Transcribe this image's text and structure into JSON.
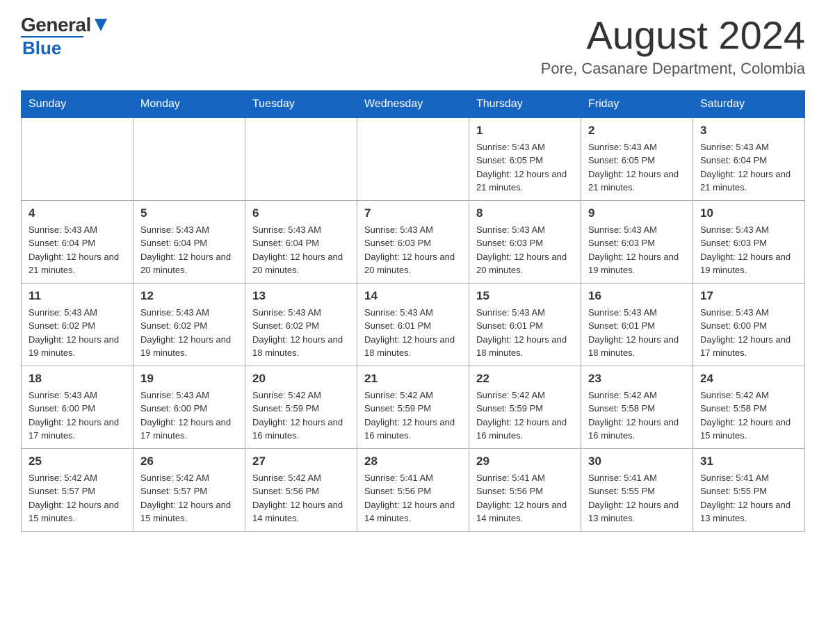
{
  "header": {
    "logo_general": "General",
    "logo_blue": "Blue",
    "month_title": "August 2024",
    "location": "Pore, Casanare Department, Colombia"
  },
  "days_of_week": [
    "Sunday",
    "Monday",
    "Tuesday",
    "Wednesday",
    "Thursday",
    "Friday",
    "Saturday"
  ],
  "weeks": [
    [
      {
        "day": "",
        "sunrise": "",
        "sunset": "",
        "daylight": ""
      },
      {
        "day": "",
        "sunrise": "",
        "sunset": "",
        "daylight": ""
      },
      {
        "day": "",
        "sunrise": "",
        "sunset": "",
        "daylight": ""
      },
      {
        "day": "",
        "sunrise": "",
        "sunset": "",
        "daylight": ""
      },
      {
        "day": "1",
        "sunrise": "Sunrise: 5:43 AM",
        "sunset": "Sunset: 6:05 PM",
        "daylight": "Daylight: 12 hours and 21 minutes."
      },
      {
        "day": "2",
        "sunrise": "Sunrise: 5:43 AM",
        "sunset": "Sunset: 6:05 PM",
        "daylight": "Daylight: 12 hours and 21 minutes."
      },
      {
        "day": "3",
        "sunrise": "Sunrise: 5:43 AM",
        "sunset": "Sunset: 6:04 PM",
        "daylight": "Daylight: 12 hours and 21 minutes."
      }
    ],
    [
      {
        "day": "4",
        "sunrise": "Sunrise: 5:43 AM",
        "sunset": "Sunset: 6:04 PM",
        "daylight": "Daylight: 12 hours and 21 minutes."
      },
      {
        "day": "5",
        "sunrise": "Sunrise: 5:43 AM",
        "sunset": "Sunset: 6:04 PM",
        "daylight": "Daylight: 12 hours and 20 minutes."
      },
      {
        "day": "6",
        "sunrise": "Sunrise: 5:43 AM",
        "sunset": "Sunset: 6:04 PM",
        "daylight": "Daylight: 12 hours and 20 minutes."
      },
      {
        "day": "7",
        "sunrise": "Sunrise: 5:43 AM",
        "sunset": "Sunset: 6:03 PM",
        "daylight": "Daylight: 12 hours and 20 minutes."
      },
      {
        "day": "8",
        "sunrise": "Sunrise: 5:43 AM",
        "sunset": "Sunset: 6:03 PM",
        "daylight": "Daylight: 12 hours and 20 minutes."
      },
      {
        "day": "9",
        "sunrise": "Sunrise: 5:43 AM",
        "sunset": "Sunset: 6:03 PM",
        "daylight": "Daylight: 12 hours and 19 minutes."
      },
      {
        "day": "10",
        "sunrise": "Sunrise: 5:43 AM",
        "sunset": "Sunset: 6:03 PM",
        "daylight": "Daylight: 12 hours and 19 minutes."
      }
    ],
    [
      {
        "day": "11",
        "sunrise": "Sunrise: 5:43 AM",
        "sunset": "Sunset: 6:02 PM",
        "daylight": "Daylight: 12 hours and 19 minutes."
      },
      {
        "day": "12",
        "sunrise": "Sunrise: 5:43 AM",
        "sunset": "Sunset: 6:02 PM",
        "daylight": "Daylight: 12 hours and 19 minutes."
      },
      {
        "day": "13",
        "sunrise": "Sunrise: 5:43 AM",
        "sunset": "Sunset: 6:02 PM",
        "daylight": "Daylight: 12 hours and 18 minutes."
      },
      {
        "day": "14",
        "sunrise": "Sunrise: 5:43 AM",
        "sunset": "Sunset: 6:01 PM",
        "daylight": "Daylight: 12 hours and 18 minutes."
      },
      {
        "day": "15",
        "sunrise": "Sunrise: 5:43 AM",
        "sunset": "Sunset: 6:01 PM",
        "daylight": "Daylight: 12 hours and 18 minutes."
      },
      {
        "day": "16",
        "sunrise": "Sunrise: 5:43 AM",
        "sunset": "Sunset: 6:01 PM",
        "daylight": "Daylight: 12 hours and 18 minutes."
      },
      {
        "day": "17",
        "sunrise": "Sunrise: 5:43 AM",
        "sunset": "Sunset: 6:00 PM",
        "daylight": "Daylight: 12 hours and 17 minutes."
      }
    ],
    [
      {
        "day": "18",
        "sunrise": "Sunrise: 5:43 AM",
        "sunset": "Sunset: 6:00 PM",
        "daylight": "Daylight: 12 hours and 17 minutes."
      },
      {
        "day": "19",
        "sunrise": "Sunrise: 5:43 AM",
        "sunset": "Sunset: 6:00 PM",
        "daylight": "Daylight: 12 hours and 17 minutes."
      },
      {
        "day": "20",
        "sunrise": "Sunrise: 5:42 AM",
        "sunset": "Sunset: 5:59 PM",
        "daylight": "Daylight: 12 hours and 16 minutes."
      },
      {
        "day": "21",
        "sunrise": "Sunrise: 5:42 AM",
        "sunset": "Sunset: 5:59 PM",
        "daylight": "Daylight: 12 hours and 16 minutes."
      },
      {
        "day": "22",
        "sunrise": "Sunrise: 5:42 AM",
        "sunset": "Sunset: 5:59 PM",
        "daylight": "Daylight: 12 hours and 16 minutes."
      },
      {
        "day": "23",
        "sunrise": "Sunrise: 5:42 AM",
        "sunset": "Sunset: 5:58 PM",
        "daylight": "Daylight: 12 hours and 16 minutes."
      },
      {
        "day": "24",
        "sunrise": "Sunrise: 5:42 AM",
        "sunset": "Sunset: 5:58 PM",
        "daylight": "Daylight: 12 hours and 15 minutes."
      }
    ],
    [
      {
        "day": "25",
        "sunrise": "Sunrise: 5:42 AM",
        "sunset": "Sunset: 5:57 PM",
        "daylight": "Daylight: 12 hours and 15 minutes."
      },
      {
        "day": "26",
        "sunrise": "Sunrise: 5:42 AM",
        "sunset": "Sunset: 5:57 PM",
        "daylight": "Daylight: 12 hours and 15 minutes."
      },
      {
        "day": "27",
        "sunrise": "Sunrise: 5:42 AM",
        "sunset": "Sunset: 5:56 PM",
        "daylight": "Daylight: 12 hours and 14 minutes."
      },
      {
        "day": "28",
        "sunrise": "Sunrise: 5:41 AM",
        "sunset": "Sunset: 5:56 PM",
        "daylight": "Daylight: 12 hours and 14 minutes."
      },
      {
        "day": "29",
        "sunrise": "Sunrise: 5:41 AM",
        "sunset": "Sunset: 5:56 PM",
        "daylight": "Daylight: 12 hours and 14 minutes."
      },
      {
        "day": "30",
        "sunrise": "Sunrise: 5:41 AM",
        "sunset": "Sunset: 5:55 PM",
        "daylight": "Daylight: 12 hours and 13 minutes."
      },
      {
        "day": "31",
        "sunrise": "Sunrise: 5:41 AM",
        "sunset": "Sunset: 5:55 PM",
        "daylight": "Daylight: 12 hours and 13 minutes."
      }
    ]
  ]
}
